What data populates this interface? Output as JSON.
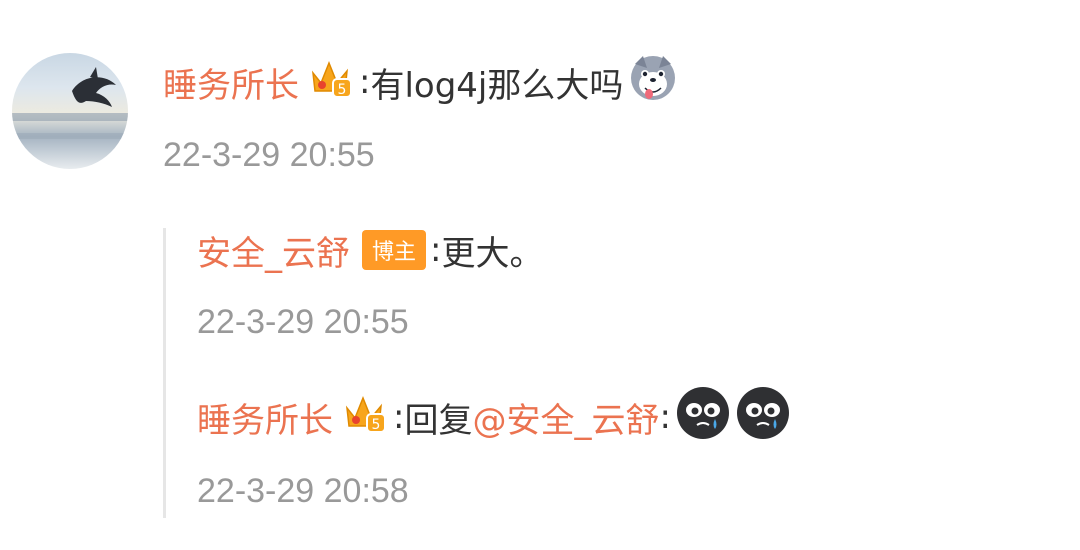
{
  "comment": {
    "user": "睡务所长",
    "separator": ":",
    "text": "有log4j那么大吗",
    "time": "22-3-29 20:55",
    "member_level": "5",
    "emoji_icon": "husky-tongue-emoji"
  },
  "replies": [
    {
      "user": "安全_云舒",
      "badge": "博主",
      "separator": ":",
      "text": "更大。",
      "time": "22-3-29 20:55"
    },
    {
      "user": "睡务所长",
      "member_level": "5",
      "separator": ":",
      "prefix": "回复",
      "mention": "@安全_云舒",
      "mention_sep": ":",
      "time": "22-3-29 20:58",
      "emoji_icons": [
        "crying-face-emoji",
        "crying-face-emoji"
      ]
    }
  ],
  "colors": {
    "username": "#eb7350",
    "timestamp": "#999999",
    "badge_bg": "#ff9a26",
    "crown": "#f7a51c"
  }
}
